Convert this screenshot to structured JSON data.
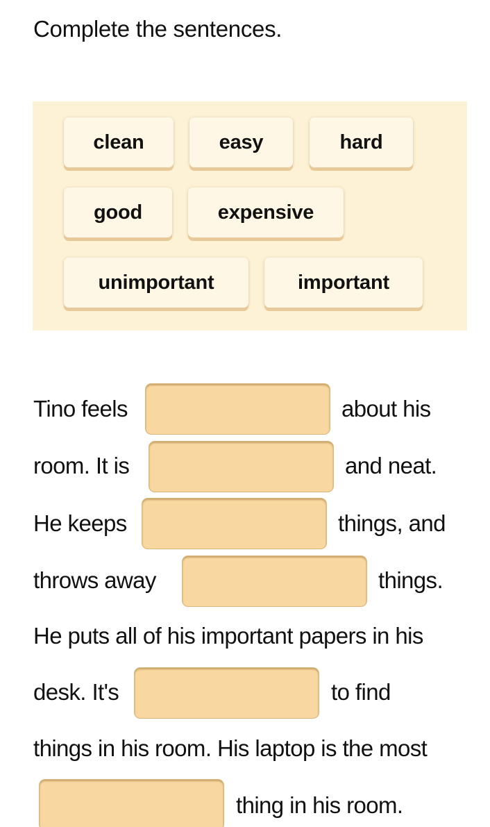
{
  "instruction": "Complete the sentences.",
  "word_bank": {
    "words": [
      "clean",
      "easy",
      "hard",
      "good",
      "expensive",
      "unimportant",
      "important"
    ]
  },
  "sentences": {
    "line1": {
      "before": "Tino feels",
      "after": "about his"
    },
    "line2": {
      "before": "room. It is",
      "after": "and neat."
    },
    "line3": {
      "before": "He keeps",
      "after": "things, and"
    },
    "line4": {
      "before": "throws away",
      "after": "things."
    },
    "line5": {
      "text": "He puts all of his important papers in his"
    },
    "line6": {
      "before": "desk. It's",
      "after": "to find"
    },
    "line7": {
      "text": "things in his room. His laptop is the most"
    },
    "line8": {
      "after": "thing in his room."
    }
  },
  "blanks": [
    "",
    "",
    "",
    "",
    "",
    ""
  ],
  "colors": {
    "word_bank_bg": "#fdf2d6",
    "tile_bg": "#fff7e5",
    "blank_bg": "#f8d8a0"
  }
}
